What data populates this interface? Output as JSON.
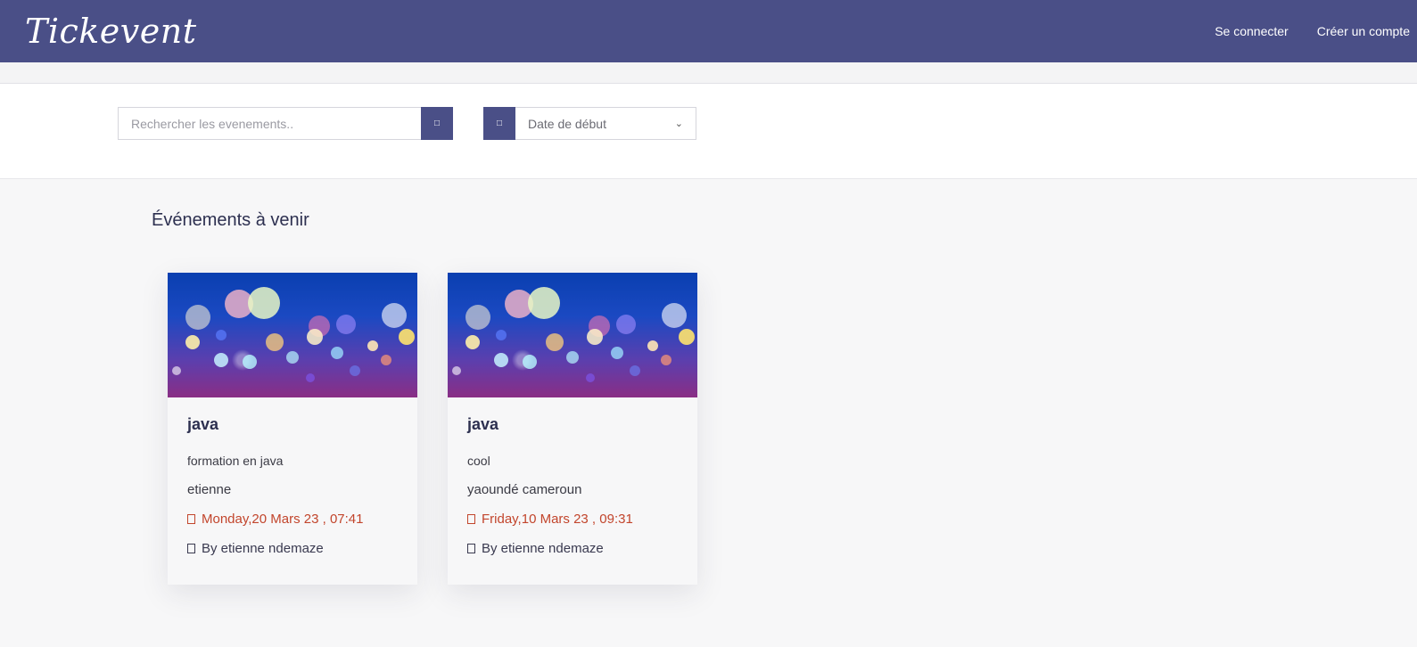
{
  "header": {
    "logo": "Tickevent",
    "nav": {
      "login": "Se connecter",
      "signup": "Créer un compte"
    }
  },
  "filters": {
    "search_placeholder": "Rechercher les evenements..",
    "search_button_icon": "search-icon",
    "date_icon": "calendar-icon",
    "date_select_value": "Date de début"
  },
  "section": {
    "title": "Événements à venir"
  },
  "events": [
    {
      "title": "java",
      "description": "formation en java",
      "place": "etienne",
      "date": "Monday,20 Mars 23 , 07:41",
      "author": "By etienne ndemaze"
    },
    {
      "title": "java",
      "description": "cool",
      "place": "yaoundé cameroun",
      "date": "Friday,10 Mars 23 , 09:31",
      "author": "By etienne ndemaze"
    }
  ],
  "colors": {
    "brand": "#4a4f87",
    "date_accent": "#c2452c"
  }
}
